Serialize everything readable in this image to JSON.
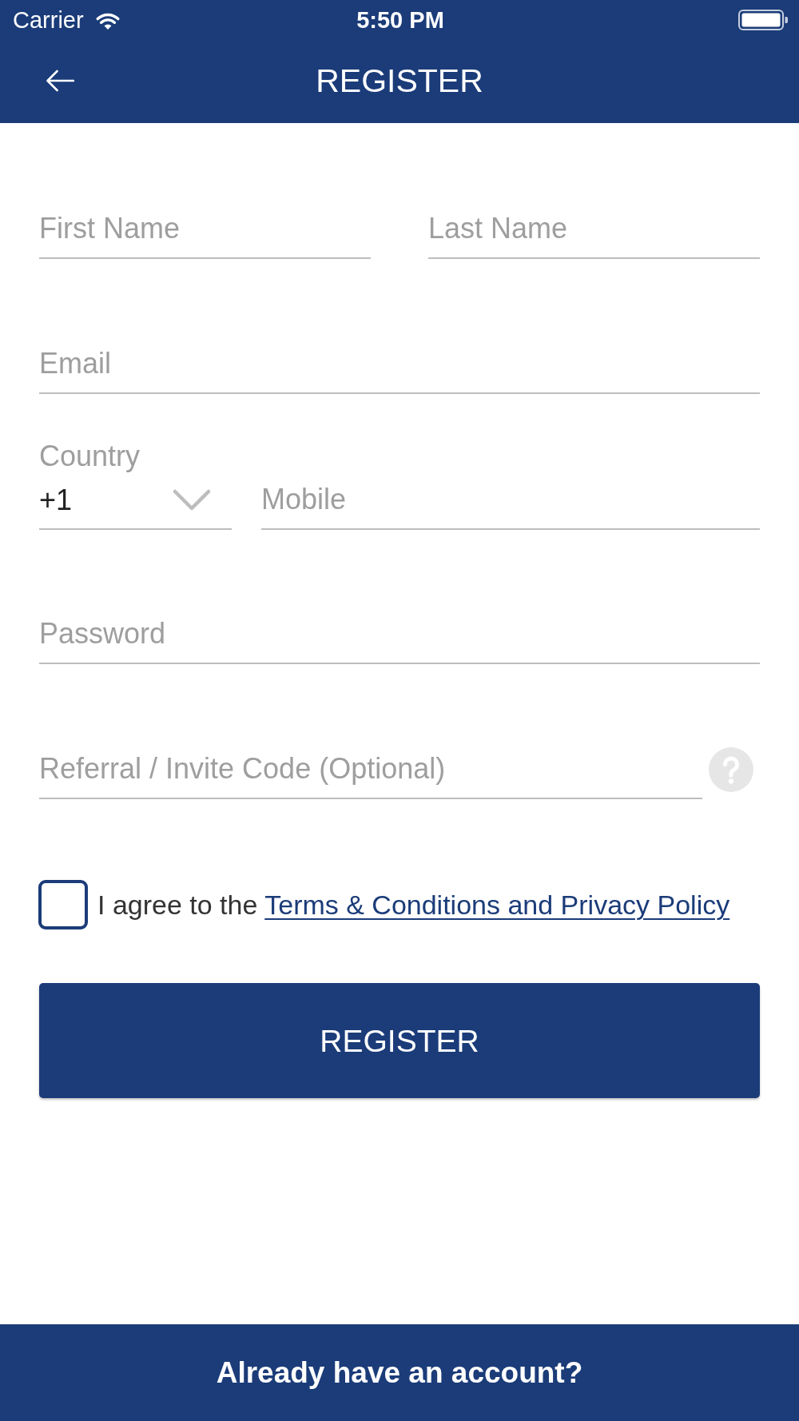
{
  "status_bar": {
    "carrier": "Carrier",
    "time": "5:50 PM"
  },
  "header": {
    "title": "REGISTER"
  },
  "form": {
    "name_fields": [
      {
        "placeholder": "First Name"
      },
      {
        "placeholder": "Last Name"
      }
    ],
    "email": {
      "placeholder": "Email"
    },
    "country": {
      "label": "Country",
      "value": "+1"
    },
    "mobile": {
      "placeholder": "Mobile"
    },
    "password": {
      "placeholder": "Password"
    },
    "referral": {
      "placeholder": "Referral / Invite Code (Optional)"
    },
    "agreement": {
      "checked": false,
      "text": "I agree to the",
      "link": "Terms & Conditions and Privacy Policy"
    },
    "submit_button": "REGISTER"
  },
  "footer": {
    "button": "Already have an account?"
  }
}
